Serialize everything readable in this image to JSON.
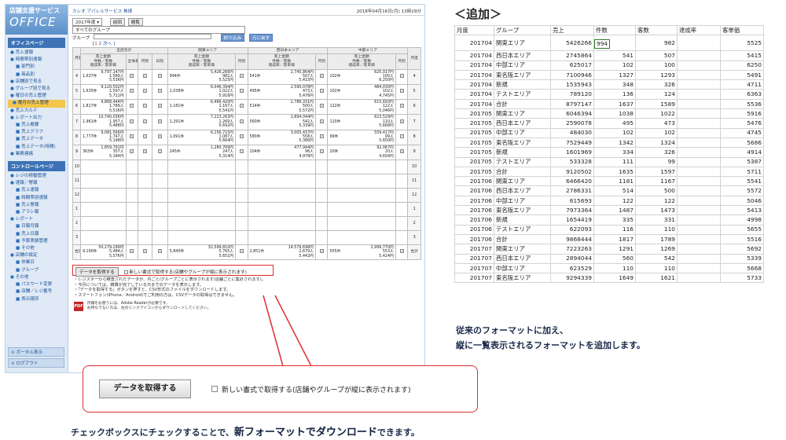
{
  "sidebar": {
    "logo_line1": "店舗支援サービス",
    "logo_line2": "OFFICE",
    "sections": [
      {
        "header": "オフィスページ",
        "items": [
          {
            "label": "売上速報",
            "sub": false
          },
          {
            "label": "時間帯別速報",
            "sub": false
          },
          {
            "label": "部門別",
            "sub": true
          },
          {
            "label": "商品別",
            "sub": true
          },
          {
            "label": "店舗別で見る",
            "sub": false
          },
          {
            "label": "グループ別で見る",
            "sub": false
          },
          {
            "label": "曜日の売上管理",
            "sub": false
          },
          {
            "label": "曜月の売上管理",
            "sub": false,
            "active": true
          },
          {
            "label": "売上カルテ",
            "sub": false
          },
          {
            "label": "レポート出力",
            "sub": false
          },
          {
            "label": "売上概要",
            "sub": true
          },
          {
            "label": "売上グラフ",
            "sub": true
          },
          {
            "label": "売上データ",
            "sub": true
          },
          {
            "label": "売上データ(時間)",
            "sub": true
          },
          {
            "label": "業務連絡",
            "sub": false
          }
        ]
      },
      {
        "header": "コントロールページ",
        "items": [
          {
            "label": "レジの稼働管理",
            "sub": false
          },
          {
            "label": "速報／警報",
            "sub": false
          },
          {
            "label": "売上速報",
            "sub": true
          },
          {
            "label": "時間帯別速報",
            "sub": true
          },
          {
            "label": "売上警報",
            "sub": true
          },
          {
            "label": "アラシ報",
            "sub": true
          },
          {
            "label": "レポート",
            "sub": false
          },
          {
            "label": "日報月報",
            "sub": true
          },
          {
            "label": "売上日報",
            "sub": true
          },
          {
            "label": "予算実績管理",
            "sub": true
          },
          {
            "label": "その他",
            "sub": true
          },
          {
            "label": "店舗の設定",
            "sub": false
          },
          {
            "label": "休業日",
            "sub": true
          },
          {
            "label": "グループ",
            "sub": true
          },
          {
            "label": "その他",
            "sub": false
          },
          {
            "label": "パスワード変更",
            "sub": true
          },
          {
            "label": "店舗／レジ番号",
            "sub": true
          },
          {
            "label": "表示順序",
            "sub": true
          }
        ]
      }
    ],
    "bottom_buttons": [
      "ポータル表示",
      "ログアウト"
    ]
  },
  "topbar": {
    "company": "カシオ アパレルサービス 株様",
    "datetime": "2018年04月16日(月) 13時29分"
  },
  "controls": {
    "year_select": "2017年度 ▾",
    "btn_prev": "前回",
    "btn_view": "閲覧",
    "group_select": "すべてのグループ",
    "group_label": "グループ",
    "btn_add": "絞り込み",
    "btn_show": "元に戻す",
    "pager_prefix": "[",
    "pager_current": "1",
    "pager_rest": " 2 次へ ]"
  },
  "grid": {
    "h_month": "月度",
    "h_total": "全店合計",
    "h_kanto": "関東エリア",
    "h_west": "西日本エリア",
    "h_chubu": "中部エリア",
    "h_sales": "売上金額",
    "h_cnt": "件数／客数",
    "h_rate": "達成率／客単価",
    "h_disp": "全体表示",
    "h_mo": "月別",
    "h_day": "日別",
    "rows": [
      {
        "m": "4",
        "t": [
          "9,797,147円",
          "1,589人",
          "5,536円"
        ],
        "tc": "1,637件",
        "k": [
          "5,426,266円",
          "982人",
          "5,525円"
        ],
        "kc": "994件",
        "w": [
          "2,745,864円",
          "507人",
          "5,415円"
        ],
        "wc": "541件",
        "c": [
          "625,017円",
          "100人",
          "6,250円"
        ],
        "cc": "102件"
      },
      {
        "m": "5",
        "t": [
          "9,120,502円",
          "1,597人",
          "5,711円"
        ],
        "tc": "1,635件",
        "k": [
          "6,046,394円",
          "1,022人",
          "5,916円"
        ],
        "kc": "1,038件",
        "w": [
          "2,590,078円",
          "473人",
          "5,476円"
        ],
        "wc": "495件",
        "c": [
          "484,030円",
          "102人",
          "4,745円"
        ],
        "cc": "102件"
      },
      {
        "m": "6",
        "t": [
          "9,868,444円",
          "1,789人",
          "5,516円"
        ],
        "tc": "1,817件",
        "k": [
          "6,466,420円",
          "1,167人",
          "5,541円"
        ],
        "kc": "1,181件",
        "w": [
          "2,786,331円",
          "500人",
          "5,572円"
        ],
        "wc": "514件",
        "c": [
          "615,693円",
          "122人",
          "5,046円"
        ],
        "cc": "122件"
      },
      {
        "m": "7",
        "t": [
          "10,740,036円",
          "1,957人",
          "5,488円"
        ],
        "tc": "1,961件",
        "k": [
          "7,223,263円",
          "1,269人",
          "5,692円"
        ],
        "kc": "1,291件",
        "w": [
          "2,894,044円",
          "542人",
          "5,339円"
        ],
        "wc": "560件",
        "c": [
          "623,529円",
          "110人",
          "5,668円"
        ],
        "cc": "110件"
      },
      {
        "m": "8",
        "t": [
          "9,081,569円",
          "1,747人",
          "5,198円"
        ],
        "tc": "1,777件",
        "k": [
          "6,156,715円",
          "1,087人",
          "5,664円"
        ],
        "kc": "1,091件",
        "w": [
          "3,005,437円",
          "558人",
          "5,386円"
        ],
        "wc": "580件",
        "c": [
          "559,417円",
          "99人",
          "5,650円"
        ],
        "cc": "99件"
      },
      {
        "m": "9",
        "t": [
          "1,859,791円",
          "357人",
          "5,184円"
        ],
        "tc": "363件",
        "k": [
          "1,280,769円",
          "247人",
          "5,314円"
        ],
        "kc": "245件",
        "w": [
          "477,944円",
          "96人",
          "4,978円"
        ],
        "wc": "104件",
        "c": [
          "92,067円",
          "20人",
          "4,604円"
        ],
        "cc": "20件"
      },
      {
        "m": "10"
      },
      {
        "m": "11"
      },
      {
        "m": "12"
      },
      {
        "m": "1"
      },
      {
        "m": "2"
      },
      {
        "m": "3"
      },
      {
        "m": "合計",
        "t": [
          "50,179,299円",
          "5,484人",
          "5,576円"
        ],
        "tc": "9,190件",
        "k": [
          "32,599,810円",
          "5,765人",
          "5,651円"
        ],
        "kc": "5,840件",
        "w": [
          "14,579,698円",
          "2,679人",
          "5,442円"
        ],
        "wc": "2,851件",
        "c": [
          "2,999,770円",
          "553人",
          "5,424円"
        ],
        "cc": "555件"
      }
    ]
  },
  "fetch": {
    "button": "データを取得する",
    "checkbox_label": "新しい書式で取得する(店舗やグループが縦に表示されます)"
  },
  "notes": [
    "・レジスターから精査されたデータが、月ごと/グループごとに表示されます(店舗ごとに集計されます)。",
    "・今月については、精算が完了している日までのデータを表示します。",
    "・「データを取得する」ボタンを押すと、CSV形式のファイルをダウンロードします。",
    "・スマートフォン(iPhone／Android)でご利用の方は、CSVデータの取得はできません。"
  ],
  "pdf": {
    "icon_text": "PDF",
    "line1": "月報をお使うには、Adobe Readerが必要です。",
    "line2": "お持ちでない方は、左のリンクアイコンからダウンロードしてください。"
  },
  "callout": {
    "button": "データを取得する",
    "checkbox_label": "新しい書式で取得する(店舗やグループが縦に表示されます)"
  },
  "caption": {
    "pre": "チェックボックスにチェックすることで、",
    "em": "新フォーマットでダウンロード",
    "post": "できます。"
  },
  "right": {
    "header": "＜追加＞",
    "columns": [
      "月度",
      "グループ",
      "売上",
      "件数",
      "客数",
      "達成率",
      "客単価"
    ],
    "rows": [
      [
        "201704",
        "関東エリア",
        "5426266",
        "994",
        "982",
        "",
        "5525"
      ],
      [
        "201704",
        "西日本エリア",
        "2745864",
        "541",
        "507",
        "",
        "5415"
      ],
      [
        "201704",
        "中部エリア",
        "625017",
        "102",
        "100",
        "",
        "6250"
      ],
      [
        "201704",
        "東名阪エリア",
        "7100946",
        "1327",
        "1293",
        "",
        "5491"
      ],
      [
        "201704",
        "新規",
        "1535943",
        "348",
        "326",
        "",
        "4711"
      ],
      [
        "201704",
        "テストエリア",
        "789120",
        "136",
        "124",
        "",
        "6363"
      ],
      [
        "201704",
        "合計",
        "8797147",
        "1637",
        "1589",
        "",
        "5536"
      ],
      [
        "201705",
        "関東エリア",
        "6046394",
        "1038",
        "1022",
        "",
        "5916"
      ],
      [
        "201705",
        "西日本エリア",
        "2590078",
        "495",
        "473",
        "",
        "5476"
      ],
      [
        "201705",
        "中部エリア",
        "484030",
        "102",
        "102",
        "",
        "4745"
      ],
      [
        "201705",
        "東名阪エリア",
        "7529449",
        "1342",
        "1324",
        "",
        "5686"
      ],
      [
        "201705",
        "新規",
        "1601969",
        "334",
        "326",
        "",
        "4914"
      ],
      [
        "201705",
        "テストエリア",
        "533328",
        "111",
        "99",
        "",
        "5387"
      ],
      [
        "201705",
        "合計",
        "9120502",
        "1635",
        "1597",
        "",
        "5711"
      ],
      [
        "201706",
        "関東エリア",
        "6466420",
        "1181",
        "1167",
        "",
        "5541"
      ],
      [
        "201706",
        "西日本エリア",
        "2786331",
        "514",
        "500",
        "",
        "5572"
      ],
      [
        "201706",
        "中部エリア",
        "615693",
        "122",
        "122",
        "",
        "5046"
      ],
      [
        "201706",
        "東名阪エリア",
        "7973364",
        "1487",
        "1473",
        "",
        "5413"
      ],
      [
        "201706",
        "新規",
        "1654419",
        "335",
        "331",
        "",
        "4998"
      ],
      [
        "201706",
        "テストエリア",
        "622093",
        "116",
        "110",
        "",
        "5655"
      ],
      [
        "201706",
        "合計",
        "9868444",
        "1817",
        "1789",
        "",
        "5516"
      ],
      [
        "201707",
        "関東エリア",
        "7223263",
        "1291",
        "1269",
        "",
        "5692"
      ],
      [
        "201707",
        "西日本エリア",
        "2894044",
        "560",
        "542",
        "",
        "5339"
      ],
      [
        "201707",
        "中部エリア",
        "623529",
        "110",
        "110",
        "",
        "5668"
      ],
      [
        "201707",
        "東名阪エリア",
        "9294339",
        "1649",
        "1621",
        "",
        "5733"
      ]
    ],
    "note_line1": "従来のフォーマットに加え、",
    "note_line2": "縦に一覧表示されるフォーマットを追加します。"
  }
}
